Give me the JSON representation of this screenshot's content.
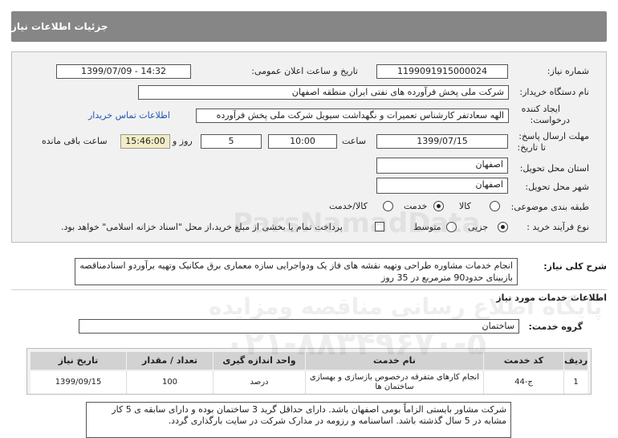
{
  "header": {
    "title": "جزئیات اطلاعات نیاز"
  },
  "fields": {
    "need_number_label": "شماره نیاز:",
    "need_number": "1199091915000024",
    "announce_label": "تاریخ و ساعت اعلان عمومی:",
    "announce_value": "1399/07/09 - 14:32",
    "buyer_label": "نام دستگاه خریدار:",
    "buyer_value": "شرکت ملی پخش فرآورده های نفتی ایران منطقه اصفهان",
    "creator_label_1": "ایجاد کننده",
    "creator_label_2": "درخواست:",
    "creator_value": "الهه سعادتفر کارشناس تعمیرات و نگهداشت سیویل شرکت ملی پخش فرآورده",
    "contact_link": "اطلاعات تماس خریدار",
    "deadline_label_1": "مهلت ارسال پاسخ:",
    "deadline_label_2": "تا تاریخ:",
    "deadline_date": "1399/07/15",
    "time_label": "ساعت",
    "deadline_time": "10:00",
    "days_value": "5",
    "days_label": "روز و",
    "remaining_time": "15:46:00",
    "remaining_label": "ساعت باقی مانده",
    "province_label": "استان محل تحویل:",
    "province_value": "اصفهان",
    "city_label": "شهر محل تحویل:",
    "city_value": "اصفهان",
    "category_label": "طبقه بندی موضوعی:",
    "category_options": [
      "کالا",
      "خدمت",
      "کالا/خدمت"
    ],
    "category_selected": "خدمت",
    "process_label": "نوع فرآیند خرید :",
    "process_options": [
      "جزیی",
      "متوسط"
    ],
    "process_selected": "جزیی",
    "payment_text": "پرداخت تمام یا بخشی از مبلغ خرید،از محل \"اسناد خزانه اسلامی\" خواهد بود."
  },
  "description": {
    "label": "شرح کلی نیاز:",
    "text": "انجام خدمات مشاوره طراحی وتهیه نقشه های فاز یک ودواجرایی سازه معماری برق مکانیک وتهیه برآوردو اسنادمناقصه بازبینای حدود90 مترمربع در 35 روز"
  },
  "services": {
    "section_title": "اطلاعات خدمات مورد نیاز",
    "group_label": "گروه خدمت:",
    "group_value": "ساختمان",
    "table": {
      "headers": [
        "ردیف",
        "کد خدمت",
        "نام خدمت",
        "واحد اندازه گیری",
        "تعداد / مقدار",
        "تاریخ نیاز"
      ],
      "rows": [
        [
          "1",
          "ج-44",
          "انجام کارهای متفرقه درخصوص بازسازی و بهسازی ساختمان ها",
          "درصد",
          "100",
          "1399/09/15"
        ]
      ]
    }
  },
  "note": {
    "text": "شرکت مشاور بایستی الزاماً بومی اصفهان باشد. دارای حداقل گرید 3 ساختمان بوده و دارای سابقه ی 5 کار مشابه در 5 سال گذشته باشد. اساسنامه و رزومه در مدارک شرکت در سایت بارگذاری گردد."
  },
  "watermark": {
    "line1": "ParsNamadData",
    "line2": "پایگاه اطلاع رسانی مناقصه ومزایده",
    "line3": "۰۲۱-۸۸۳۴۹۶۷۰-۵"
  },
  "colors": {
    "header_bg": "#868686",
    "panel_bg": "#f1f1f1",
    "link": "#1e57b4",
    "remaining_bg": "#f2edc6"
  }
}
